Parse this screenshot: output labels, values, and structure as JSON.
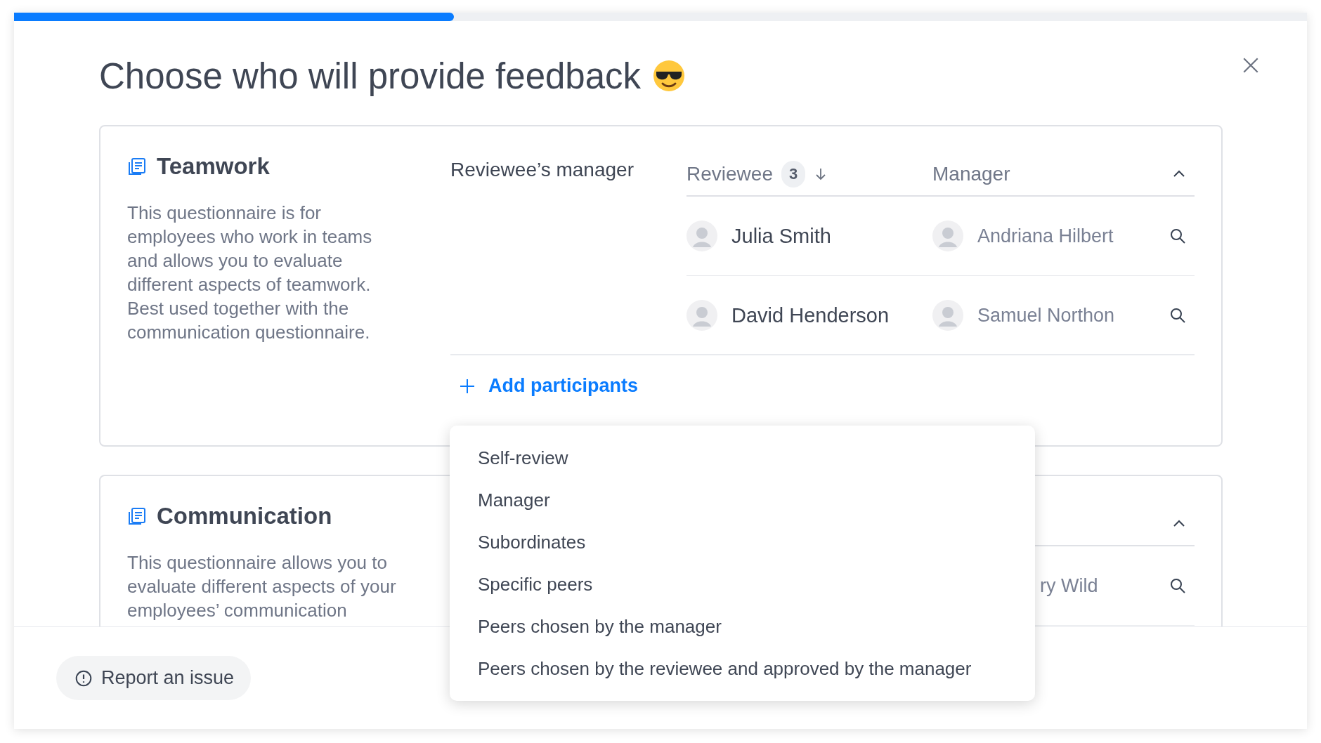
{
  "progress": {
    "level": 0.34
  },
  "title": "Choose who will provide feedback",
  "sections": [
    {
      "title": "Teamwork",
      "description": "This questionnaire is for employees who work in teams and allows you to evaluate different aspects of teamwork. Best used together with the communication questionnaire.",
      "expanded": true,
      "role": "Reviewee’s manager",
      "columns": [
        {
          "label": "Reviewee",
          "count": "3"
        },
        {
          "label": "Manager"
        }
      ],
      "rows": [
        {
          "reviewee": "Julia Smith",
          "manager": "Andriana Hilbert"
        },
        {
          "reviewee": "David Henderson",
          "manager": "Samuel Northon"
        }
      ],
      "add_label": "Add participants"
    },
    {
      "title": "Communication",
      "description": "This questionnaire allows you to evaluate different aspects of your employees’ communication",
      "expanded": true,
      "rows": [
        {
          "manager": "ry Wild"
        }
      ]
    }
  ],
  "menu": {
    "items": [
      {
        "label": "Self-review"
      },
      {
        "label": "Manager"
      },
      {
        "label": "Subordinates"
      },
      {
        "label": "Specific peers"
      },
      {
        "label": "Peers chosen by the manager"
      },
      {
        "label": "Peers chosen by the reviewee and approved by the manager"
      }
    ]
  },
  "footer": {
    "report_label": "Report an issue"
  }
}
